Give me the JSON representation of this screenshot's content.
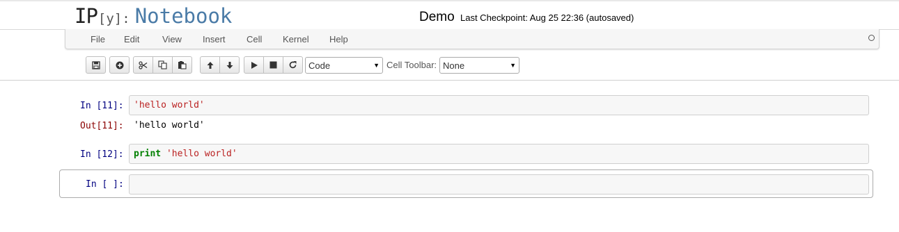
{
  "header": {
    "logo": {
      "ip": "IP",
      "y": "[y]:",
      "notebook": "Notebook"
    },
    "notebook_name": "Demo",
    "checkpoint": "Last Checkpoint: Aug 25 22:36 (autosaved)"
  },
  "menubar": {
    "items": [
      "File",
      "Edit",
      "View",
      "Insert",
      "Cell",
      "Kernel",
      "Help"
    ]
  },
  "toolbar": {
    "cell_type_value": "Code",
    "cell_toolbar_label": "Cell Toolbar:",
    "cell_toolbar_value": "None",
    "icons": [
      "save-icon",
      "insert-cell-icon",
      "cut-icon",
      "copy-icon",
      "paste-icon",
      "move-up-icon",
      "move-down-icon",
      "run-icon",
      "interrupt-icon",
      "restart-icon"
    ]
  },
  "cells": [
    {
      "prompt": "In [11]:",
      "code_string": "'hello world'",
      "output_prompt": "Out[11]:",
      "output": "'hello world'"
    },
    {
      "prompt": "In [12]:",
      "code_keyword": "print",
      "code_string": "'hello world'"
    },
    {
      "prompt": "In [ ]:",
      "code": ""
    }
  ],
  "colors": {
    "prompt_in": "#000080",
    "prompt_out": "#8b0000",
    "string": "#ba2121",
    "keyword": "#008000",
    "logo_notebook": "#4a7ba7"
  }
}
